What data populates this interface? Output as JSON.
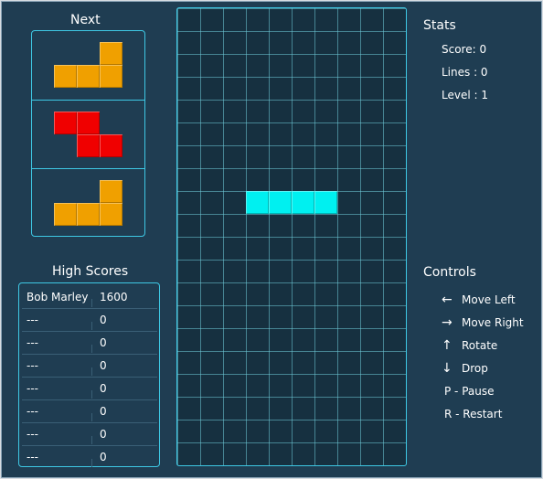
{
  "next_panel": {
    "title": "Next",
    "pieces": [
      {
        "name": "L-piece",
        "color": "#f0a000",
        "cells": [
          [
            2,
            0
          ],
          [
            0,
            1
          ],
          [
            1,
            1
          ],
          [
            2,
            1
          ]
        ]
      },
      {
        "name": "Z-piece",
        "color": "#f00000",
        "cells": [
          [
            0,
            0
          ],
          [
            1,
            0
          ],
          [
            1,
            1
          ],
          [
            2,
            1
          ]
        ]
      },
      {
        "name": "L-piece",
        "color": "#f0a000",
        "cells": [
          [
            2,
            0
          ],
          [
            0,
            1
          ],
          [
            1,
            1
          ],
          [
            2,
            1
          ]
        ]
      }
    ]
  },
  "board": {
    "columns": 10,
    "rows": 20,
    "active_piece": {
      "name": "I-piece",
      "color": "#00f0f0",
      "cells": [
        [
          3,
          8
        ],
        [
          4,
          8
        ],
        [
          5,
          8
        ],
        [
          6,
          8
        ]
      ]
    }
  },
  "high_scores": {
    "title": "High Scores",
    "rows": [
      {
        "name": "Bob Marley",
        "score": "1600"
      },
      {
        "name": "---",
        "score": "0"
      },
      {
        "name": "---",
        "score": "0"
      },
      {
        "name": "---",
        "score": "0"
      },
      {
        "name": "---",
        "score": "0"
      },
      {
        "name": "---",
        "score": "0"
      },
      {
        "name": "---",
        "score": "0"
      },
      {
        "name": "---",
        "score": "0"
      }
    ]
  },
  "stats": {
    "title": "Stats",
    "score": "Score: 0",
    "lines": "Lines : 0",
    "level": "Level : 1"
  },
  "controls": {
    "title": "Controls",
    "items": [
      {
        "icon": "arrow-left-icon",
        "glyph": "←",
        "label": "Move Left"
      },
      {
        "icon": "arrow-right-icon",
        "glyph": "→",
        "label": "Move Right"
      },
      {
        "icon": "arrow-up-icon",
        "glyph": "↑",
        "label": "Rotate"
      },
      {
        "icon": "arrow-down-icon",
        "glyph": "↓",
        "label": "Drop"
      },
      {
        "icon": "",
        "glyph": "",
        "label": "P - Pause"
      },
      {
        "icon": "",
        "glyph": "",
        "label": "R - Restart"
      }
    ]
  }
}
